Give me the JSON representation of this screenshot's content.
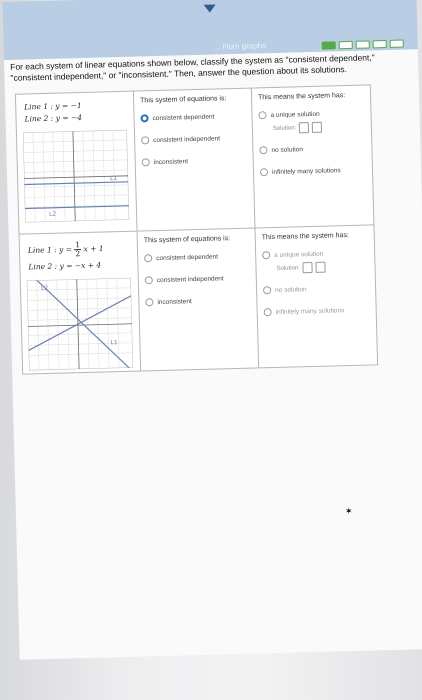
{
  "header": {
    "faint_title": "... Num graphs"
  },
  "progress": {
    "segments": [
      true,
      false,
      false,
      false,
      false
    ]
  },
  "instructions": "For each system of linear equations shown below, classify the system as \"consistent dependent,\" \"consistent independent,\" or \"inconsistent.\" Then, answer the question about its solutions.",
  "rows": [
    {
      "line1": "Line 1 : y = −1",
      "line2": "Line 2 : y = −4",
      "classification_prompt": "This system of equations is:",
      "classification_options": [
        "consistent dependent",
        "consistent independent",
        "inconsistent"
      ],
      "selected_classification": 0,
      "solutions_prompt": "This means the system has:",
      "solution_options": [
        "a unique solution",
        "no solution",
        "infinitely many solutions"
      ],
      "solution_label": "Solution:",
      "graph_labels": {
        "l1": "L1",
        "l2": "L2"
      }
    },
    {
      "line1_prefix": "Line 1 : y = ",
      "line1_num": "1",
      "line1_den": "2",
      "line1_suffix": "x + 1",
      "line2": "Line 2 : y = −x + 4",
      "classification_prompt": "This system of equations is:",
      "classification_options": [
        "consistent dependent",
        "consistent independent",
        "inconsistent"
      ],
      "selected_classification": null,
      "solutions_prompt": "This means the system has:",
      "solution_options": [
        "a unique solution",
        "no solution",
        "infinitely many solutions"
      ],
      "solution_label": "Solution:",
      "graph_labels": {
        "l1": "L1",
        "l2": "L2"
      }
    }
  ]
}
